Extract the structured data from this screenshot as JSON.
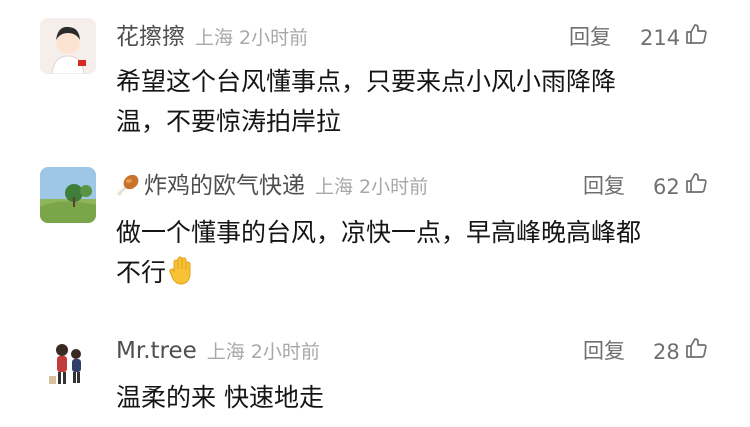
{
  "comments": [
    {
      "username": "花擦擦",
      "location": "上海",
      "time": "2小时前",
      "reply_label": "回复",
      "like_count": "214",
      "lines": [
        "希望这个台风懂事点，只要来点小风小雨降降",
        "温，不要惊涛拍岸拉"
      ]
    },
    {
      "username_prefix_icon": "drumstick-icon",
      "username": "炸鸡的欧气快递",
      "location": "上海",
      "time": "2小时前",
      "reply_label": "回复",
      "like_count": "62",
      "lines": [
        "做一个懂事的台风，凉快一点，早高峰晚高峰都",
        "不行"
      ],
      "trailing_emoji": "raised-hand-icon"
    },
    {
      "username": "Mr.tree",
      "location": "上海",
      "time": "2小时前",
      "reply_label": "回复",
      "like_count": "28",
      "lines": [
        "温柔的来 快速地走"
      ]
    }
  ],
  "colors": {
    "text": "#151515",
    "meta": "#a8a8a8",
    "secondary": "#6f6f6f"
  }
}
